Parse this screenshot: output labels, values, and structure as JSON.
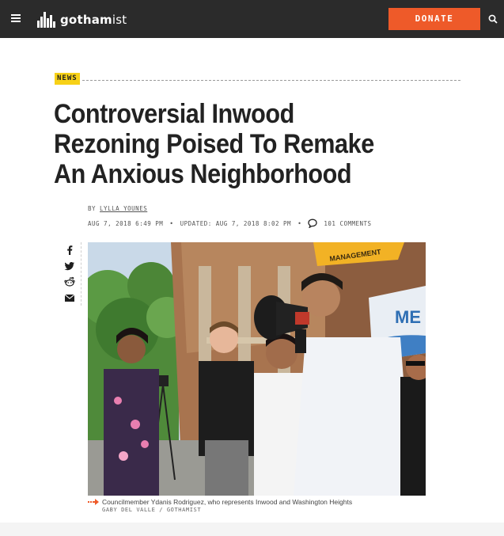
{
  "header": {
    "logo_prefix": "gotham",
    "logo_suffix": "ist",
    "donate_label": "DONATE",
    "menu_icon": "hamburger-menu-icon",
    "search_icon": "search-icon",
    "background": "#2b2b2b",
    "accent": "#ee5a29"
  },
  "article": {
    "category": "NEWS",
    "category_color": "#f7d117",
    "title": "Controversial Inwood Rezoning Poised To Remake An Anxious Neighborhood",
    "byline_prefix": "BY",
    "author": "LYLLA YOUNES",
    "published": "AUG 7, 2018 6:49 PM",
    "dot": "•",
    "updated_label": "UPDATED:",
    "updated": "AUG 7, 2018 8:02 PM",
    "comments": "101 COMMENTS"
  },
  "share": {
    "icons": [
      "facebook-icon",
      "twitter-icon",
      "reddit-icon",
      "email-icon"
    ]
  },
  "image": {
    "caption": "Councilmember Ydanis Rodriguez, who represents Inwood and Washington Heights",
    "credit": "GABY DEL VALLE / GOTHAMIST",
    "sign_text": "MANAGEMENT",
    "banner_text": "ME"
  }
}
